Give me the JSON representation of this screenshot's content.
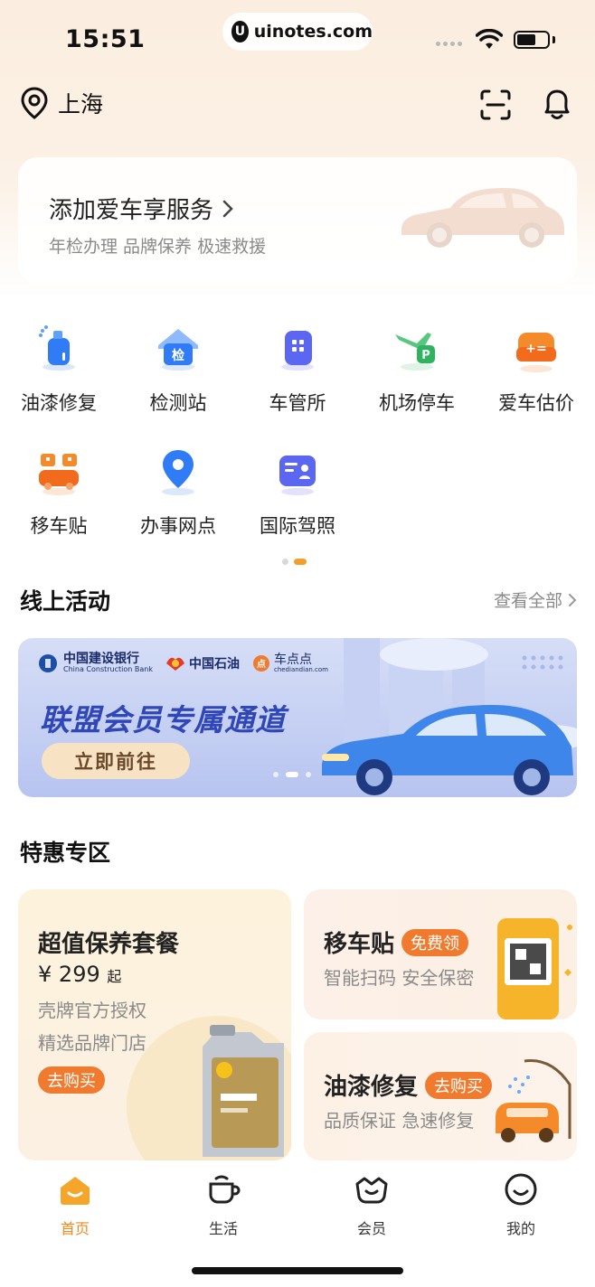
{
  "status_bar": {
    "time": "15:51",
    "url": "uinotes.com",
    "url_logo": "U"
  },
  "header": {
    "city": "上海",
    "location_icon": "location-pin-icon",
    "scan_icon": "scan-icon",
    "bell_icon": "bell-icon"
  },
  "add_car": {
    "title": "添加爱车享服务",
    "subtitle": "年检办理 品牌保养 极速救援"
  },
  "services": [
    {
      "label": "油漆修复",
      "icon": "spray-paint-icon"
    },
    {
      "label": "检测站",
      "icon": "inspection-house-icon"
    },
    {
      "label": "车管所",
      "icon": "vehicle-office-icon"
    },
    {
      "label": "机场停车",
      "icon": "airport-parking-icon"
    },
    {
      "label": "爱车估价",
      "icon": "car-valuation-icon"
    },
    {
      "label": "移车贴",
      "icon": "move-car-sticker-icon"
    },
    {
      "label": "办事网点",
      "icon": "service-point-icon"
    },
    {
      "label": "国际驾照",
      "icon": "international-license-icon"
    }
  ],
  "activities": {
    "title": "线上活动",
    "view_all": "查看全部",
    "banner": {
      "bank": "中国建设银行",
      "bank_en": "China Construction Bank",
      "oil": "中国石油",
      "app": "车点点",
      "app_url": "chediandian.com",
      "title": "联盟会员专属通道",
      "button": "立即前往"
    }
  },
  "deals": {
    "title": "特惠专区",
    "big": {
      "title": "超值保养套餐",
      "currency": "¥",
      "price": "299",
      "price_suffix": "起",
      "line1": "壳牌官方授权",
      "line2": "精选品牌门店",
      "button": "去购买"
    },
    "right1": {
      "title": "移车贴",
      "tag": "免费领",
      "subtitle": "智能扫码 安全保密"
    },
    "right2": {
      "title": "油漆修复",
      "tag": "去购买",
      "subtitle": "品质保证 急速修复"
    }
  },
  "tabbar": [
    {
      "label": "首页",
      "icon": "home-icon",
      "active": true
    },
    {
      "label": "生活",
      "icon": "cup-icon",
      "active": false
    },
    {
      "label": "会员",
      "icon": "member-icon",
      "active": false
    },
    {
      "label": "我的",
      "icon": "profile-icon",
      "active": false
    }
  ],
  "colors": {
    "accent": "#f07a2e",
    "active_tab": "#f08a1c",
    "banner_title": "#2f47b8"
  }
}
